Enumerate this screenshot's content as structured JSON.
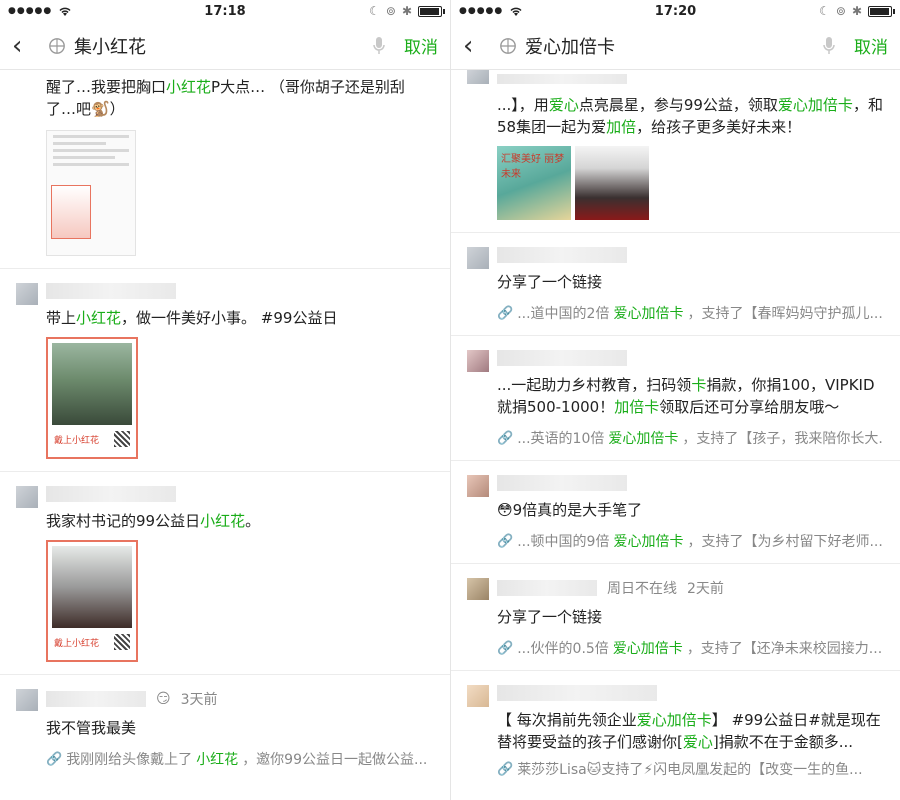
{
  "left": {
    "status": {
      "carrier": "●●●●●",
      "time": "17:18",
      "battery_level": 0.85
    },
    "header": {
      "title": "集小红花",
      "cancel": "取消"
    },
    "items": [
      {
        "text_pre": "醒了…我要把胸口",
        "text_hl": "小红花",
        "text_post": "P大点… （哥你胡子还是别刮了…吧🐒）"
      },
      {
        "text_pre": "带上",
        "text_hl": "小红花",
        "text_post": "，做一件美好小事。 #99公益日",
        "poster_caption": "戴上小红花"
      },
      {
        "text_pre": "我家村书记的99公益日",
        "text_hl": "小红花",
        "text_post": "。",
        "poster_caption": "戴上小红花"
      },
      {
        "time": "3天前",
        "emoji": "😏",
        "text": "我不管我最美",
        "link_pre": "我刚刚给头像戴上了",
        "link_hl": "小红花",
        "link_post": "，邀你99公益日一起做公益..."
      }
    ]
  },
  "right": {
    "status": {
      "carrier": "●●●●●",
      "time": "17:20",
      "battery_level": 0.85
    },
    "header": {
      "title": "爱心加倍卡",
      "cancel": "取消"
    },
    "items": [
      {
        "text_a": "...】，用",
        "hl_a": "爱心",
        "text_b": "点亮晨星，参与99公益，领取",
        "hl_b": "爱心加倍卡",
        "text_c": "，和58集团一起为爱",
        "hl_c": "加倍",
        "text_d": "，给孩子更多美好未来！",
        "thumb_title": "汇聚美好 丽梦未来"
      },
      {
        "text": "分享了一个链接",
        "link_pre": "...道中国的2倍",
        "link_hl": "爱心加倍卡",
        "link_post": "，支持了【春晖妈妈守护孤儿..."
      },
      {
        "text_a": "...一起助力乡村教育，扫码领",
        "hl_a": "卡",
        "text_b": "捐款，你捐100，VIPKID就捐500-1000！",
        "hl_b": "加倍卡",
        "text_c": "领取后还可分享给朋友哦～",
        "link_pre": "...英语的10倍",
        "link_hl": "爱心加倍卡",
        "link_post": "，支持了【孩子，我来陪你长大..."
      },
      {
        "text": "😳9倍真的是大手笔了",
        "link_pre": "...顿中国的9倍",
        "link_hl": "爱心加倍卡",
        "link_post": "，支持了【为乡村留下好老师..."
      },
      {
        "name": "周日不在线",
        "time": "2天前",
        "text": "分享了一个链接",
        "link_pre": "...伙伴的0.5倍",
        "link_hl": "爱心加倍卡",
        "link_post": "，支持了【还净未来校园接力..."
      },
      {
        "text_a": "【 每次捐前先领企业",
        "hl_a": "爱心加倍卡",
        "text_b": "】 #99公益日#就是现在 替将要受益的孩子们感谢你[",
        "hl_b": "爱心",
        "text_c": "]捐款不在于金额多...",
        "link_name": "莱莎莎Lisa🐱支持了⚡闪电凤凰发起的【改变一生的鱼..."
      }
    ]
  }
}
